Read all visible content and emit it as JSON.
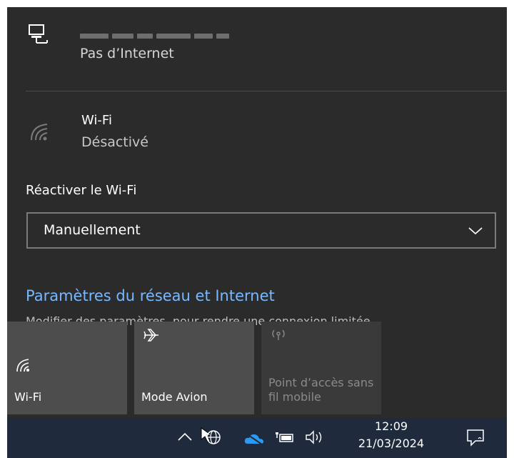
{
  "network": {
    "icon": "ethernet-computer-icon",
    "status": "Pas d’Internet"
  },
  "wifi": {
    "icon": "wifi-off-icon",
    "title": "Wi-Fi",
    "status": "Désactivé"
  },
  "reactivate": {
    "label": "Réactiver le Wi-Fi",
    "selected": "Manuellement"
  },
  "settings": {
    "link": "Paramètres du réseau et Internet",
    "description": "Modifier des paramètres, pour rendre une connexion limitée."
  },
  "quick_actions": [
    {
      "label": "Wi-Fi",
      "icon": "wifi-icon",
      "enabled": true
    },
    {
      "label": "Mode Avion",
      "icon": "airplane-icon",
      "enabled": true
    },
    {
      "label": "Point d’accès sans fil mobile",
      "icon": "mobile-hotspot-icon",
      "enabled": false
    }
  ],
  "taskbar": {
    "time": "12:09",
    "date": "21/03/2024",
    "icons": [
      "chevron-up-icon",
      "network-globe-icon",
      "onedrive-icon",
      "battery-icon",
      "speaker-icon",
      "notification-icon"
    ]
  },
  "colors": {
    "flyout_bg": "#2b2b2b",
    "tile_bg": "#4d4d4d",
    "link": "#79b8ff",
    "taskbar_bg": "#1f2a3c"
  }
}
